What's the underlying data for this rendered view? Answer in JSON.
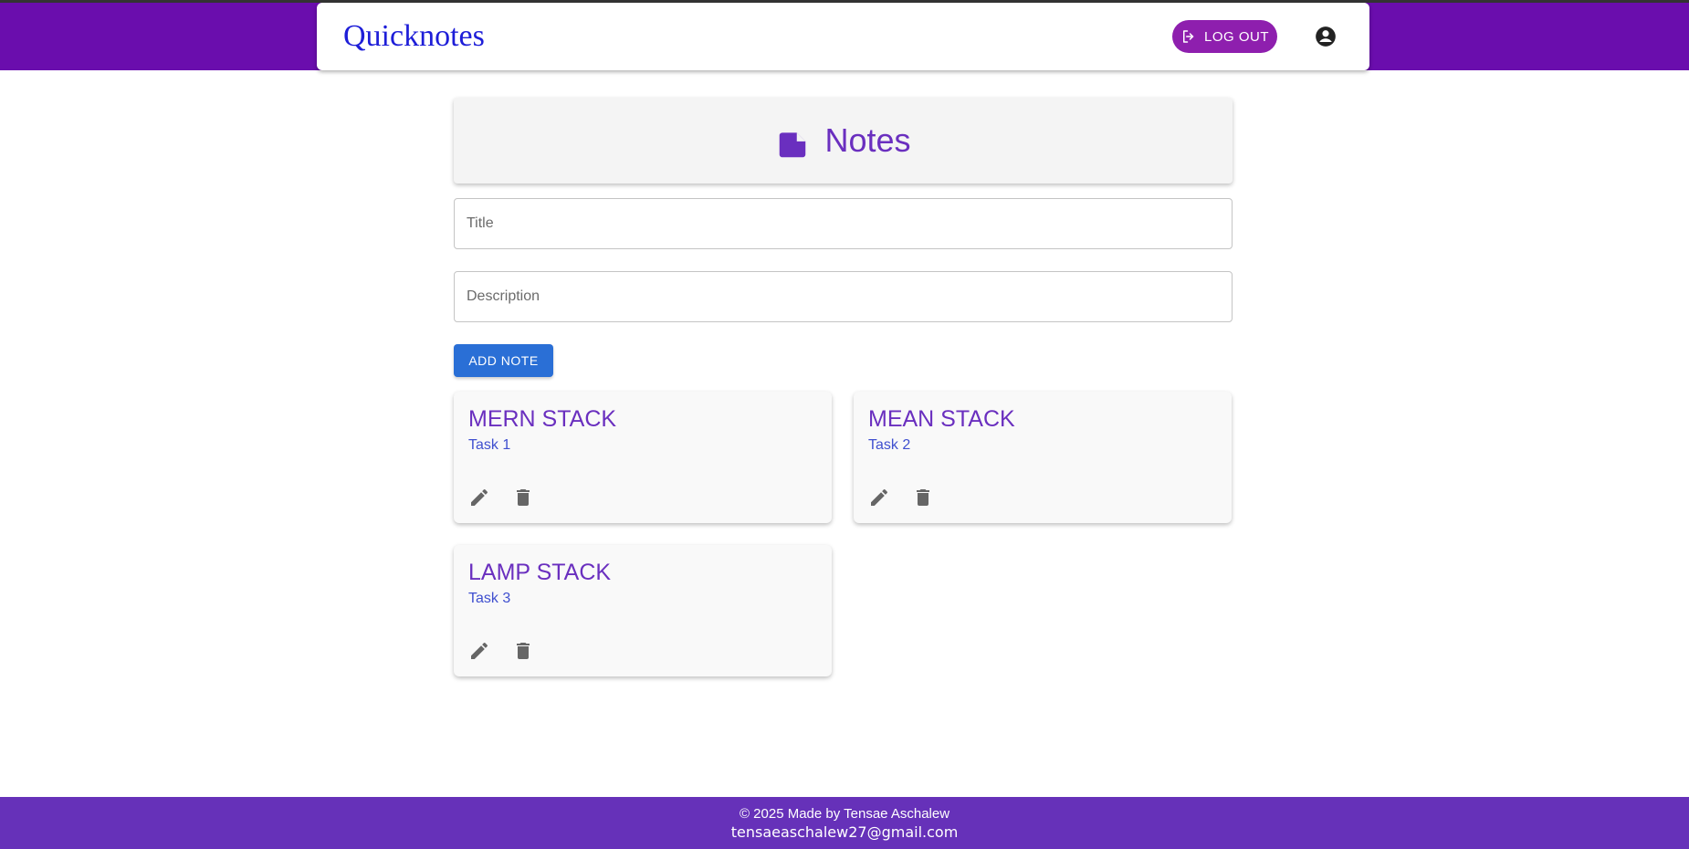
{
  "app": {
    "brand": "Quicknotes"
  },
  "navbar": {
    "logout_label": "LOG OUT"
  },
  "header": {
    "title": "Notes"
  },
  "form": {
    "title_placeholder": "Title",
    "description_placeholder": "Description",
    "title_value": "",
    "description_value": "",
    "add_label": "ADD NOTE"
  },
  "notes": [
    {
      "title": "MERN STACK",
      "description": "Task 1"
    },
    {
      "title": "MEAN STACK",
      "description": "Task 2"
    },
    {
      "title": "LAMP STACK",
      "description": "Task 3"
    }
  ],
  "footer": {
    "credit": "© 2025 Made by Tensae Aschalew",
    "email": "tensaeaschalew27@gmail.com"
  },
  "colors": {
    "appbar": "#6a0dad",
    "brand": "#1e1ed8",
    "logout": "#8e1fae",
    "accent": "#6a2fbf",
    "button": "#2a6fd6",
    "footer": "#6631b9"
  },
  "icons": [
    "logout-icon",
    "account-circle-icon",
    "note-folder-icon",
    "edit-icon",
    "delete-icon"
  ]
}
